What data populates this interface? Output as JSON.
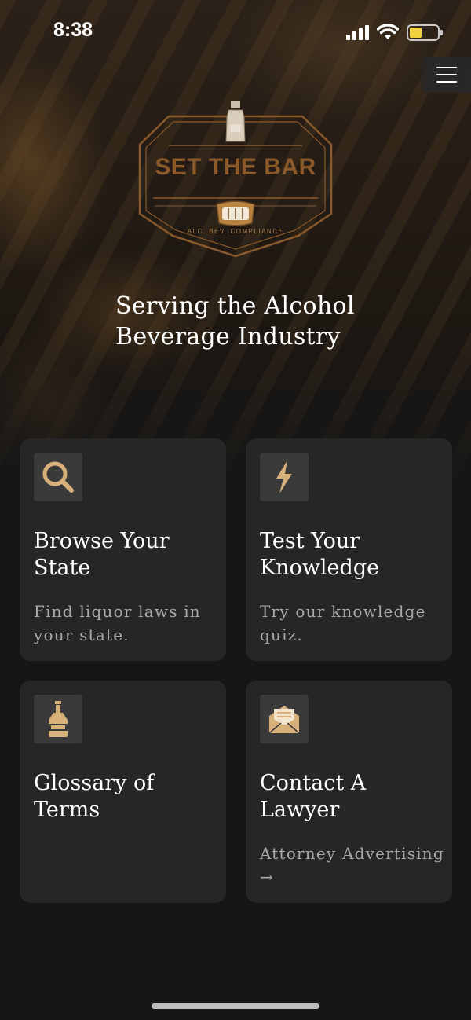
{
  "status_bar": {
    "time": "8:38"
  },
  "logo": {
    "text": "SET THE BAR",
    "subtext": "ALC. BEV. COMPLIANCE"
  },
  "tagline": "Serving the Alcohol Beverage Industry",
  "cards": [
    {
      "title": "Browse Your State",
      "desc": "Find liquor laws in your state.",
      "icon": "search-icon"
    },
    {
      "title": "Test Your Knowledge",
      "desc": "Try our knowledge quiz.",
      "icon": "lightning-icon"
    },
    {
      "title": "Glossary of Terms",
      "desc": "",
      "icon": "bottle-icon"
    },
    {
      "title": "Contact A Lawyer",
      "desc": "Attorney Advertising →",
      "icon": "envelope-icon"
    }
  ],
  "colors": {
    "accent": "#D8B07A",
    "card": "#262626",
    "icon_box": "#3A3A3A",
    "background": "#161616"
  }
}
